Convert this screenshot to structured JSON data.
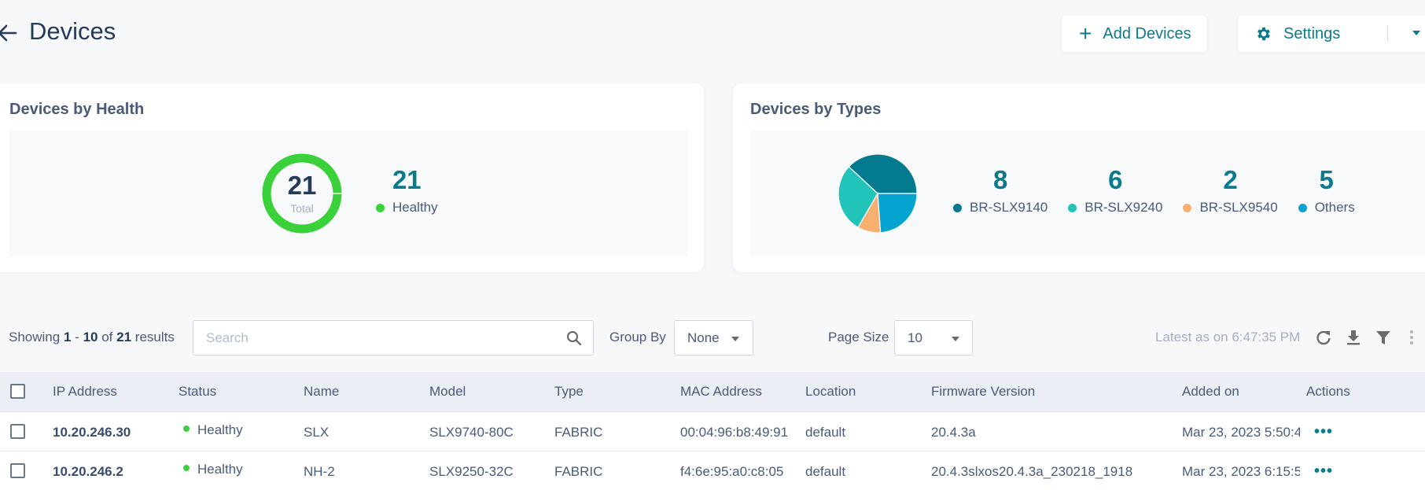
{
  "header": {
    "title": "Devices",
    "add_button": "Add Devices",
    "settings_button": "Settings"
  },
  "health_card": {
    "title": "Devices by Health",
    "total": "21",
    "total_label": "Total",
    "legend": [
      {
        "count": "21",
        "label": "Healthy",
        "color": "#3ad13a"
      }
    ]
  },
  "types_card": {
    "title": "Devices by Types",
    "legend": [
      {
        "count": "8",
        "label": "BR-SLX9140",
        "color": "#037a8e"
      },
      {
        "count": "6",
        "label": "BR-SLX9240",
        "color": "#22c3b8"
      },
      {
        "count": "2",
        "label": "BR-SLX9540",
        "color": "#f8b071"
      },
      {
        "count": "5",
        "label": "Others",
        "color": "#04a3d0"
      }
    ]
  },
  "chart_data": [
    {
      "type": "pie",
      "title": "Devices by Health",
      "categories": [
        "Healthy"
      ],
      "values": [
        21
      ],
      "total": 21,
      "colors": [
        "#3ad13a"
      ]
    },
    {
      "type": "pie",
      "title": "Devices by Types",
      "categories": [
        "BR-SLX9140",
        "BR-SLX9240",
        "BR-SLX9540",
        "Others"
      ],
      "values": [
        8,
        6,
        2,
        5
      ],
      "colors": [
        "#037a8e",
        "#22c3b8",
        "#f8b071",
        "#04a3d0"
      ]
    }
  ],
  "toolbar": {
    "showing_prefix": "Showing",
    "range_start": "1",
    "range_sep": "-",
    "range_end": "10",
    "of": "of",
    "total": "21",
    "results": "results",
    "search_placeholder": "Search",
    "search_value": "",
    "group_by_label": "Group By",
    "group_by_value": "None",
    "page_size_label": "Page Size",
    "page_size_value": "10",
    "latest": "Latest as on 6:47:35 PM"
  },
  "table": {
    "columns": [
      "IP Address",
      "Status",
      "Name",
      "Model",
      "Type",
      "MAC Address",
      "Location",
      "Firmware Version",
      "Added on",
      "Actions"
    ],
    "rows": [
      {
        "ip": "10.20.246.30",
        "status": "Healthy",
        "name": "SLX",
        "model": "SLX9740-80C",
        "type": "FABRIC",
        "mac": "00:04:96:b8:49:91",
        "location": "default",
        "firmware": "20.4.3a",
        "added": "Mar 23, 2023 5:50:4",
        "actions": "•••"
      },
      {
        "ip": "10.20.246.2",
        "status": "Healthy",
        "name": "NH-2",
        "model": "SLX9250-32C",
        "type": "FABRIC",
        "mac": "f4:6e:95:a0:c8:05",
        "location": "default",
        "firmware": "20.4.3slxos20.4.3a_230218_1918",
        "added": "Mar 23, 2023 6:15:5",
        "actions": "•••"
      }
    ]
  },
  "colors": {
    "accent": "#0b7a8c",
    "healthy": "#3ad13a"
  }
}
